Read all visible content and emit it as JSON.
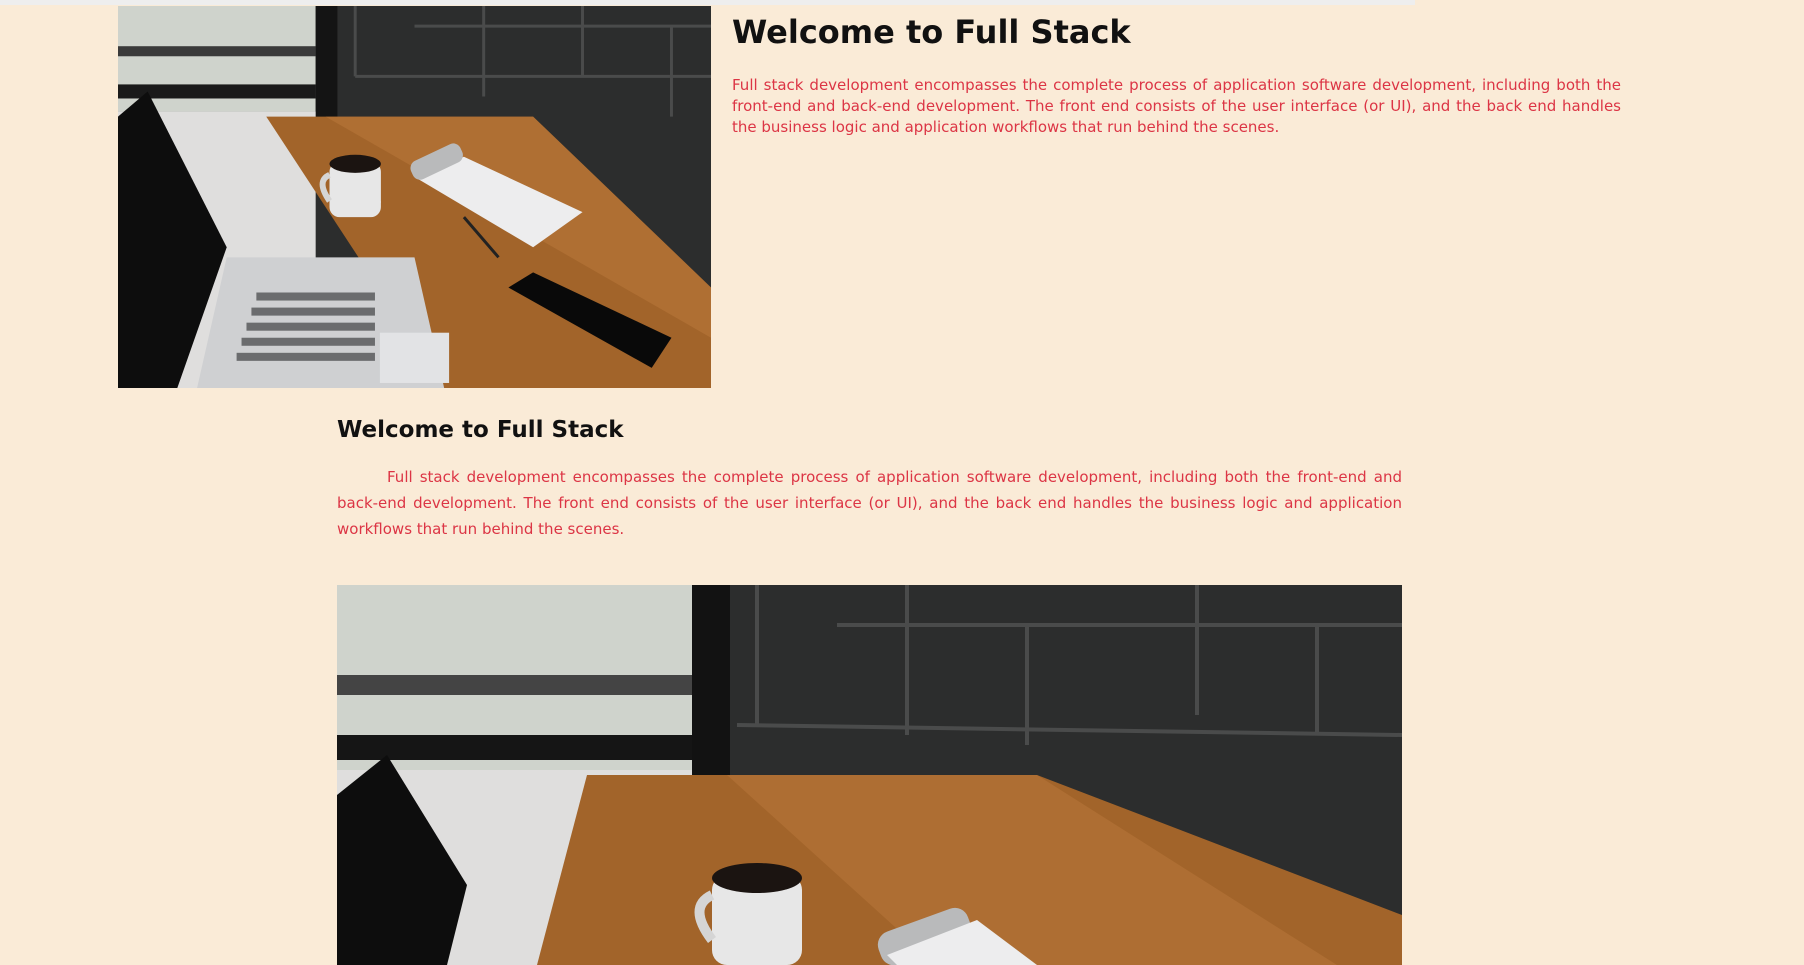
{
  "hero": {
    "title": "Welcome to Full Stack",
    "paragraph": "Full stack development encompasses the complete process of application software development, including both the front-end and back-end development. The front end consists of the user interface (or UI), and the back end handles the business logic and application workflows that run behind the scenes."
  },
  "section": {
    "title": "Welcome to Full Stack",
    "paragraph": "Full stack development encompasses the complete process of application software development, including both the front-end and back-end development. The front end consists of the user interface (or UI), and the back end handles the business logic and application workflows that run behind the scenes."
  },
  "colors": {
    "page_background": "#faebd7",
    "paragraph_text": "#dc3545",
    "heading_text": "#111111"
  }
}
